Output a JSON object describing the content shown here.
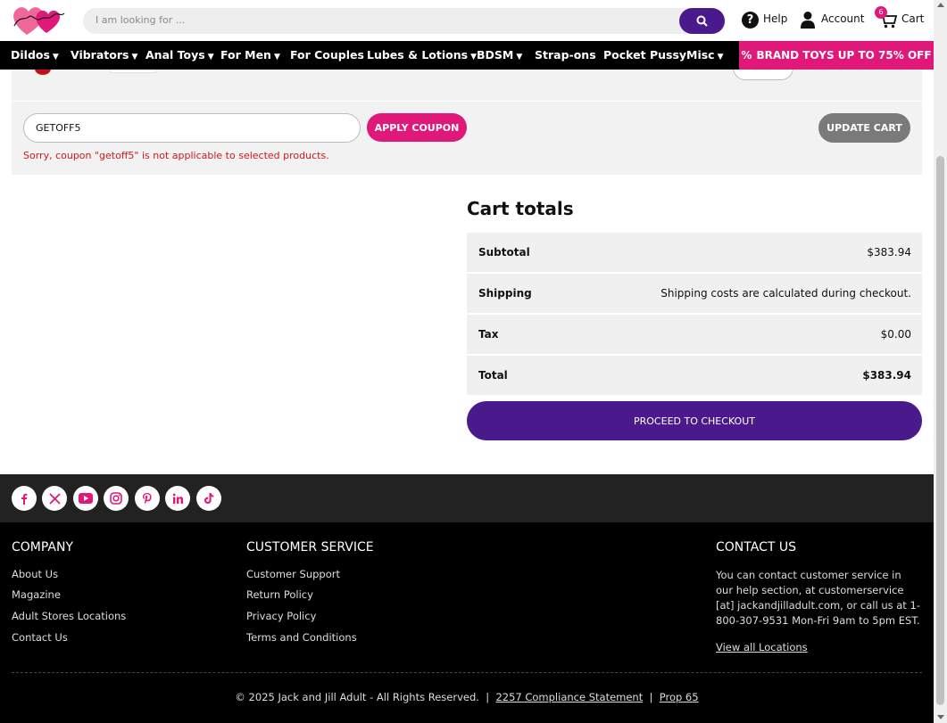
{
  "header": {
    "search_placeholder": "I am looking for ...",
    "help_label": "Help",
    "account_label": "Account",
    "cart_label": "Cart",
    "cart_count": "6"
  },
  "nav": {
    "items": [
      {
        "label": "Dildos",
        "has_dropdown": true
      },
      {
        "label": "Vibrators",
        "has_dropdown": true
      },
      {
        "label": "Anal Toys",
        "has_dropdown": true
      },
      {
        "label": "For Men",
        "has_dropdown": true
      },
      {
        "label": "For Couples",
        "has_dropdown": false
      },
      {
        "label": "Lubes & Lotions",
        "has_dropdown": true
      },
      {
        "label": "BDSM",
        "has_dropdown": true
      },
      {
        "label": "Strap-ons",
        "has_dropdown": false
      },
      {
        "label": "Pocket Pussy",
        "has_dropdown": false
      },
      {
        "label": "Misc",
        "has_dropdown": true
      }
    ],
    "promo_label": "BRAND TOYS UP TO 75% OFF"
  },
  "coupon": {
    "code_value": "GETOFF5",
    "apply_label": "APPLY COUPON",
    "update_label": "UPDATE CART",
    "error_message": "Sorry, coupon \"getoff5\" is not applicable to selected products."
  },
  "cart_totals": {
    "title": "Cart totals",
    "rows": [
      {
        "label": "Subtotal",
        "value": "$383.94"
      },
      {
        "label": "Shipping",
        "value": "Shipping costs are calculated during checkout."
      },
      {
        "label": "Tax",
        "value": "$0.00"
      },
      {
        "label": "Total",
        "value": "$383.94"
      }
    ],
    "checkout_label": "PROCEED TO CHECKOUT"
  },
  "social": [
    "facebook-icon",
    "x-icon",
    "youtube-icon",
    "instagram-icon",
    "pinterest-icon",
    "linkedin-icon",
    "tiktok-icon"
  ],
  "footer": {
    "company_title": "COMPANY",
    "company_links": [
      "About Us",
      "Magazine",
      "Adult Stores Locations",
      "Contact Us"
    ],
    "service_title": "CUSTOMER SERVICE",
    "service_links": [
      "Customer Support",
      "Return Policy",
      "Privacy Policy",
      "Terms and Conditions"
    ],
    "contact_title": "CONTACT US",
    "contact_text": "You can contact customer service in our help section, at customerservice [at] jackandjilladult.com, or call us at 1-800-307-9531 Mon-Fri 9am to 5pm EST.",
    "view_locations": "View all Locations",
    "copyright": "© 2025 Jack and Jill Adult - All Rights Reserved.",
    "compliance_link": "2257 Compliance Statement",
    "prop65_link": "Prop 65"
  },
  "colors": {
    "brand_pink": "#e0187a",
    "brand_purple": "#4a1a8c",
    "error_red": "#d01818"
  }
}
